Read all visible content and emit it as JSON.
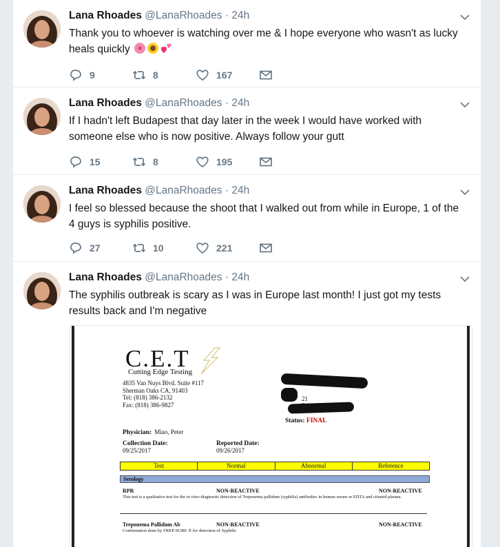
{
  "tweets": [
    {
      "name": "Lana Rhoades",
      "handle": "@LanaRhoades",
      "dot": "·",
      "time": "24h",
      "text": "Thank you to whoever is watching over me & I hope everyone who wasn't as lucky heals quickly",
      "emojis": [
        "hibiscus-emoji",
        "sunflower-emoji",
        "two-hearts-emoji"
      ],
      "replies": "9",
      "retweets": "8",
      "likes": "167"
    },
    {
      "name": "Lana Rhoades",
      "handle": "@LanaRhoades",
      "dot": "·",
      "time": "24h",
      "text": "If I hadn't left Budapest that day later in the week I would have worked with someone else who is now positive. Always follow your gutt",
      "replies": "15",
      "retweets": "8",
      "likes": "195"
    },
    {
      "name": "Lana Rhoades",
      "handle": "@LanaRhoades",
      "dot": "·",
      "time": "24h",
      "text": "I feel so blessed because the shoot that I walked out from while in Europe, 1 of the 4 guys is syphilis positive.",
      "replies": "27",
      "retweets": "10",
      "likes": "221"
    },
    {
      "name": "Lana Rhoades",
      "handle": "@LanaRhoades",
      "dot": "·",
      "time": "24h",
      "text": "The syphilis outbreak is scary as I was in Europe last month! I just got my tests results back and I'm negative"
    }
  ],
  "document": {
    "logo": "C.E.T",
    "logo_sub": "Cutting Edge Testing",
    "address": [
      "4835 Van Nuys Blvd. Suite #117",
      "Sherman Oaks CA, 91403",
      "Tel: (818) 386-2132",
      "Fax: (818) 386-9827"
    ],
    "partial_21": "21",
    "partial_f": "F",
    "status_label": "Status:",
    "status_value": "FINAL",
    "physician_label": "Physician:",
    "physician_value": "Miao, Peter",
    "collection_label": "Collection Date:",
    "collection_value": "09/25/2017",
    "reported_label": "Reported Date:",
    "reported_value": "09/26/2017",
    "table_headers": [
      "Test",
      "Normal",
      "Abnormal",
      "Reference"
    ],
    "section": "Serology",
    "tests": [
      {
        "name": "RPR",
        "normal": "NON-REACTIVE",
        "reference": "NON-REACTIVE",
        "note": "This test is a qualitative test for the in vitro diagnostic detection of Treponema pallidum (syphilis) antibodies in human serum or EDTA and citrated plasma."
      },
      {
        "name": "Treponema Pallidum Ab",
        "normal": "NON-REACTIVE",
        "reference": "NON-REACTIVE",
        "note": "Confirmation done by TREP-SURE ® for detection of Syphilis"
      }
    ]
  }
}
